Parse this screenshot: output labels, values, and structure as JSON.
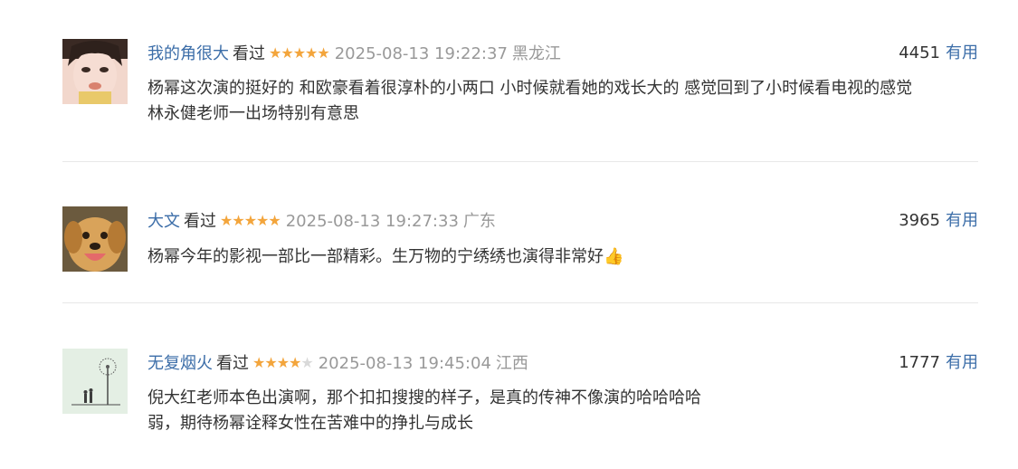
{
  "comments": [
    {
      "user": "我的角很大",
      "status": "看过",
      "rating": 5,
      "time": "2025-08-13 19:22:37",
      "location": "黑龙江",
      "votes": "4451",
      "vote_label": "有用",
      "lines": [
        "杨幂这次演的挺好的 和欧豪看着很淳朴的小两口 小时候就看她的戏长大的 感觉回到了小时候看电视的感觉",
        "林永健老师一出场特别有意思"
      ]
    },
    {
      "user": "大文",
      "status": "看过",
      "rating": 5,
      "time": "2025-08-13 19:27:33",
      "location": "广东",
      "votes": "3965",
      "vote_label": "有用",
      "lines": [
        "杨幂今年的影视一部比一部精彩。生万物的宁绣绣也演得非常好👍"
      ]
    },
    {
      "user": "无复烟火",
      "status": "看过",
      "rating": 4,
      "time": "2025-08-13 19:45:04",
      "location": "江西",
      "votes": "1777",
      "vote_label": "有用",
      "lines": [
        "倪大红老师本色出演啊，那个扣扣搜搜的样子，是真的传神不像演的哈哈哈哈",
        "弱，期待杨幂诠释女性在苦难中的挣扎与成长"
      ]
    }
  ],
  "colors": {
    "username": "#3b6da8",
    "star": "#f3a53c",
    "star_empty": "#d9d9d9",
    "meta_gray": "#999999",
    "divider": "#e8e8e8"
  }
}
